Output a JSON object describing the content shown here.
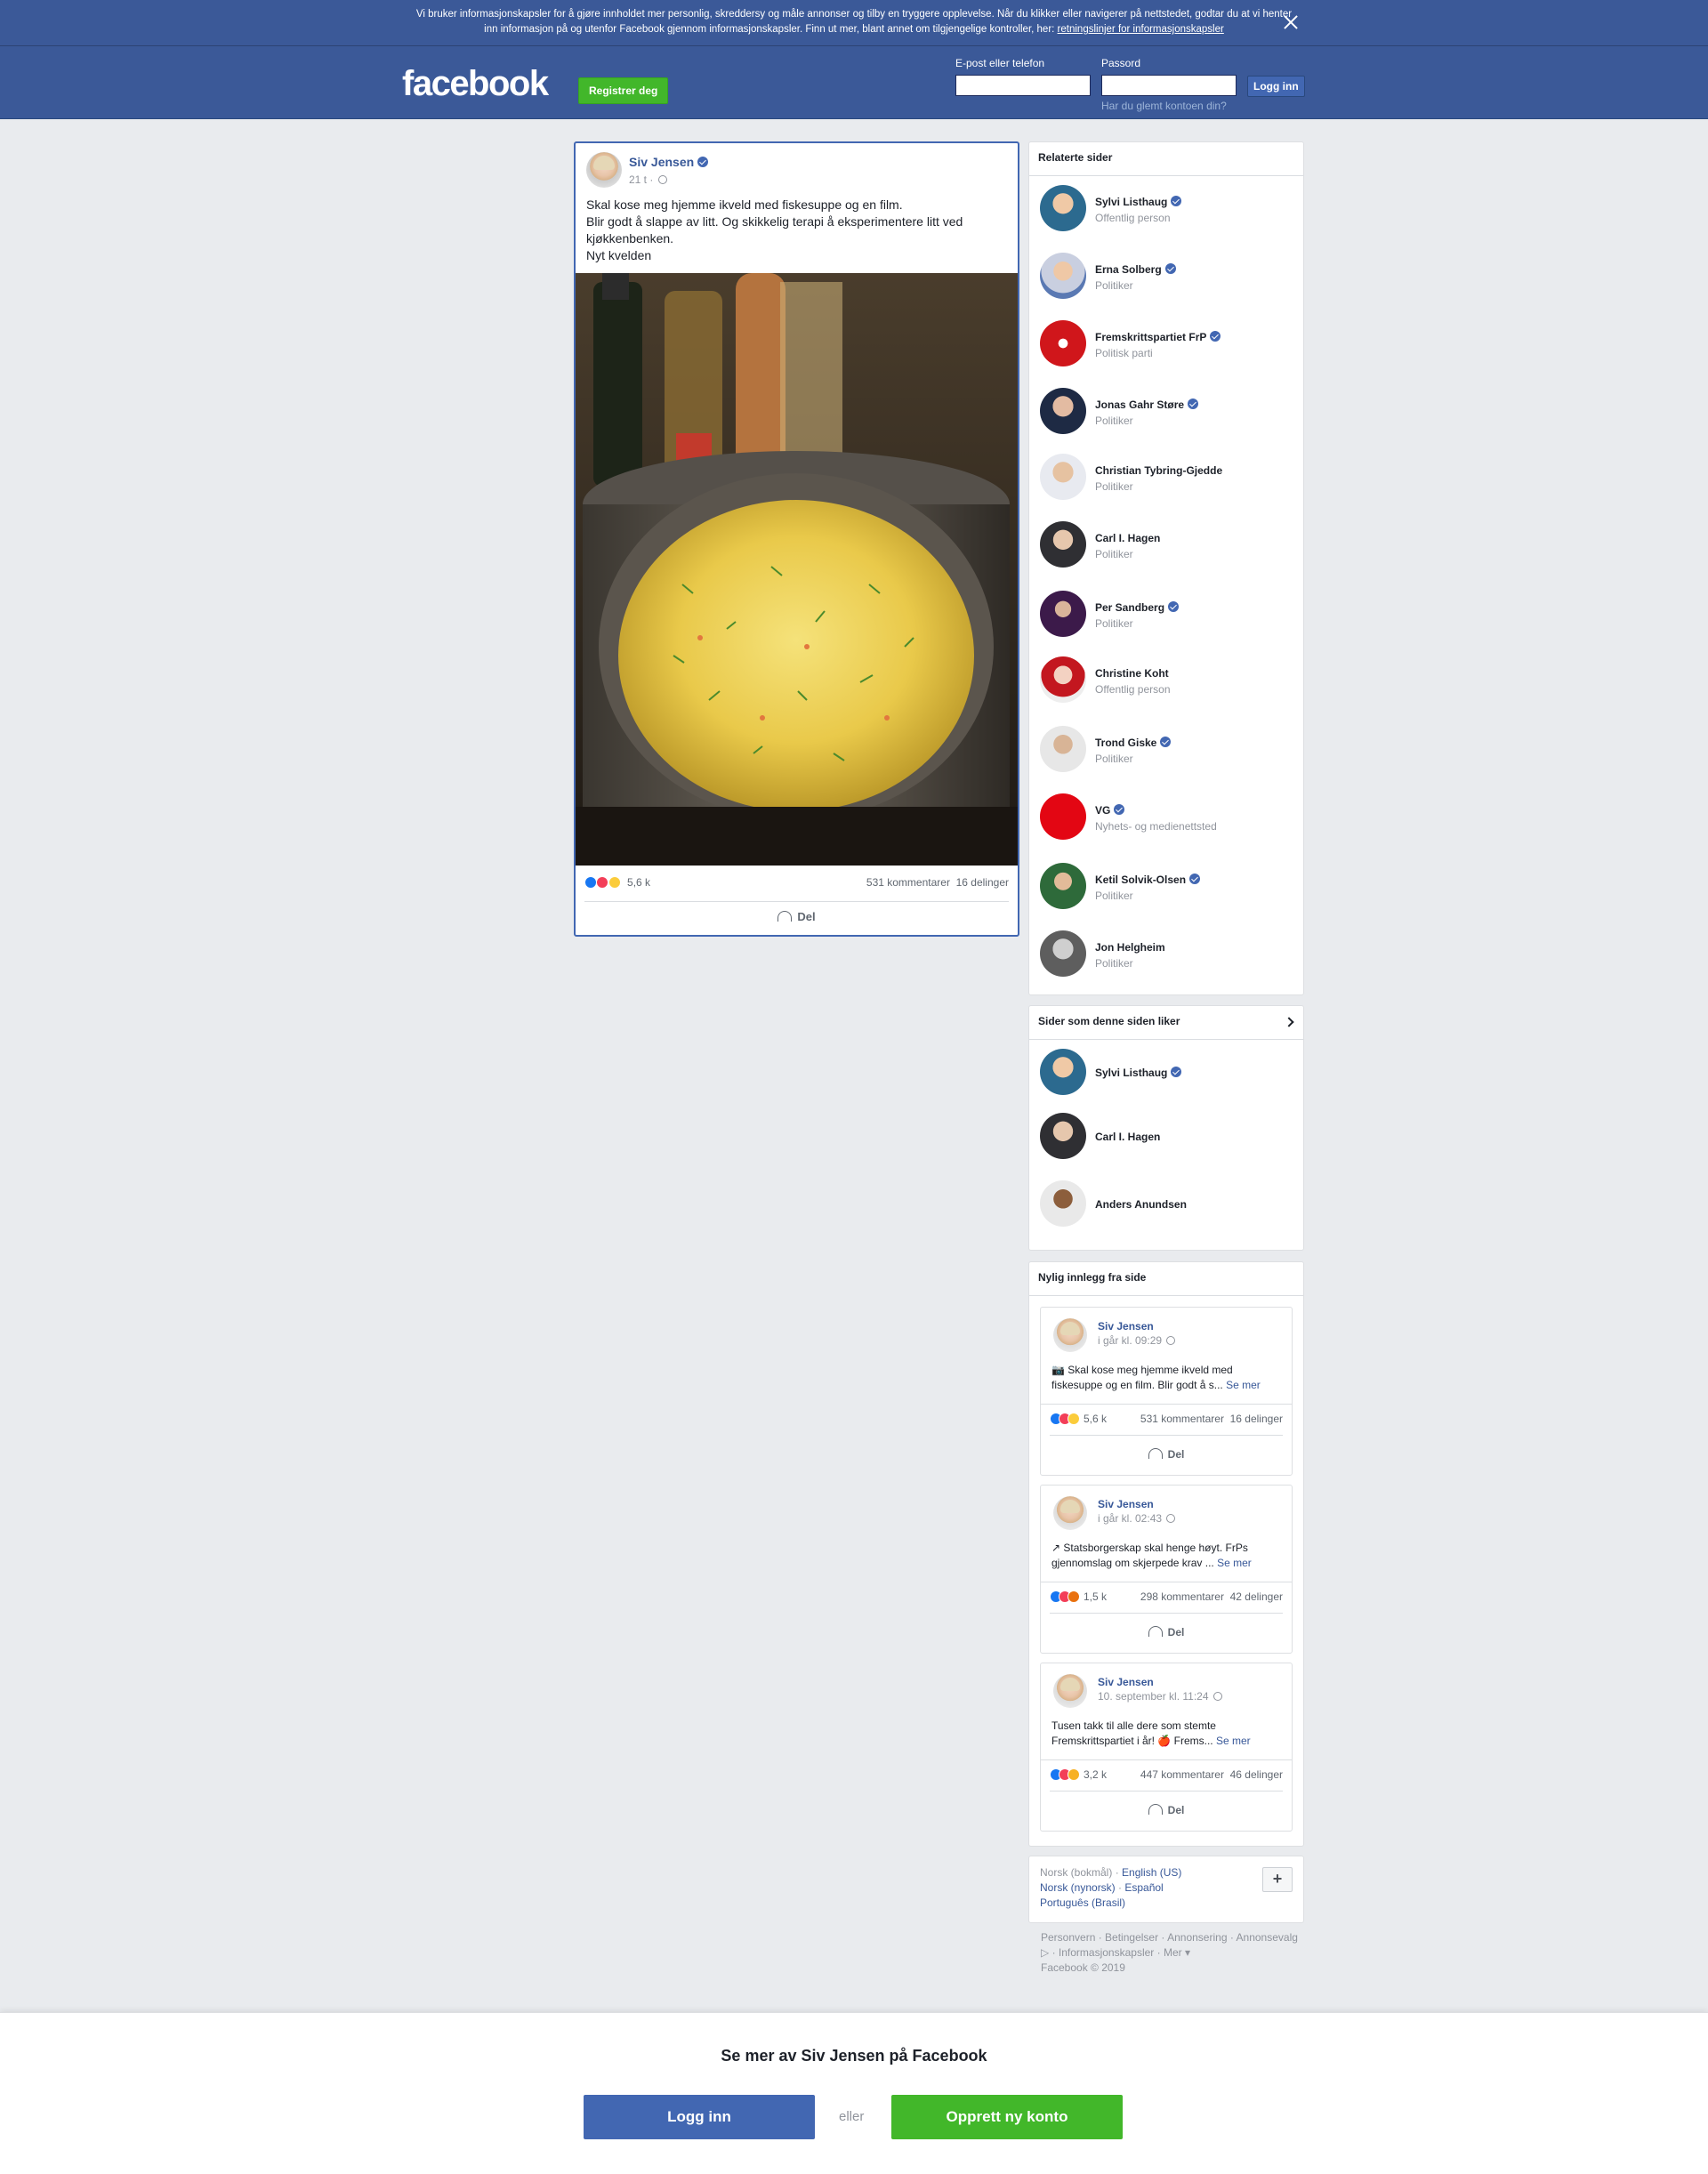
{
  "cookie_banner": {
    "text": "Vi bruker informasjonskapsler for å gjøre innholdet mer personlig, skreddersy og måle annonser og tilby en tryggere opplevelse. Når du klikker eller navigerer på nettstedet, godtar du at vi henter inn informasjon på og utenfor Facebook gjennom informasjonskapsler. Finn ut mer, blant annet om tilgjengelige kontroller, her: ",
    "link": "retningslinjer for informasjonskapsler"
  },
  "header": {
    "logo": "facebook",
    "register": "Registrer deg",
    "email_label": "E-post eller telefon",
    "password_label": "Passord",
    "login": "Logg inn",
    "forgot": "Har du glemt kontoen din?"
  },
  "post": {
    "author": "Siv Jensen",
    "time": "21 t ·",
    "text": [
      "Skal kose meg hjemme ikveld med fiskesuppe og en film.",
      "Blir godt å slappe av litt. Og skikkelig terapi å eksperimentere litt ved kjøkkenbenken.",
      "Nyt kvelden"
    ],
    "reactions_count": "5,6 k",
    "comments": "531 kommentarer",
    "shares": "16 delinger",
    "share_label": "Del"
  },
  "related": {
    "title": "Relaterte sider",
    "items": [
      {
        "name": "Sylvi Listhaug",
        "verified": true,
        "category": "Offentlig person"
      },
      {
        "name": "Erna Solberg",
        "verified": true,
        "category": "Politiker"
      },
      {
        "name": "Fremskrittspartiet FrP",
        "verified": true,
        "category": "Politisk parti"
      },
      {
        "name": "Jonas Gahr Støre",
        "verified": true,
        "category": "Politiker"
      },
      {
        "name": "Christian Tybring-Gjedde",
        "verified": false,
        "category": "Politiker"
      },
      {
        "name": "Carl I. Hagen",
        "verified": false,
        "category": "Politiker"
      },
      {
        "name": "Per Sandberg",
        "verified": true,
        "category": "Politiker"
      },
      {
        "name": "Christine Koht",
        "verified": false,
        "category": "Offentlig person"
      },
      {
        "name": "Trond Giske",
        "verified": true,
        "category": "Politiker"
      },
      {
        "name": "VG",
        "verified": true,
        "category": "Nyhets- og medienettsted"
      },
      {
        "name": "Ketil Solvik-Olsen",
        "verified": true,
        "category": "Politiker"
      },
      {
        "name": "Jon Helgheim",
        "verified": false,
        "category": "Politiker"
      }
    ]
  },
  "liked": {
    "title": "Sider som denne siden liker",
    "items": [
      {
        "name": "Sylvi Listhaug",
        "verified": true
      },
      {
        "name": "Carl I. Hagen",
        "verified": false
      },
      {
        "name": "Anders Anundsen",
        "verified": false
      }
    ]
  },
  "recent": {
    "title": "Nylig innlegg fra side",
    "posts": [
      {
        "author": "Siv Jensen",
        "time": "i går kl. 09:29",
        "text": "Skal kose meg hjemme ikveld med fiskesuppe og en film. Blir godt å s...",
        "icon": "📷",
        "see_more": "Se mer",
        "count": "5,6 k",
        "comments": "531 kommentarer",
        "shares": "16 delinger",
        "share": "Del"
      },
      {
        "author": "Siv Jensen",
        "time": "i går kl. 02:43",
        "text": "Statsborgerskap skal henge høyt. FrPs gjennomslag om skjerpede krav ...",
        "icon": "↗",
        "see_more": "Se mer",
        "count": "1,5 k",
        "comments": "298 kommentarer",
        "shares": "42 delinger",
        "share": "Del"
      },
      {
        "author": "Siv Jensen",
        "time": "10. september kl. 11:24",
        "text": "Tusen takk til alle dere som stemte Fremskrittspartiet i år! 🍎 Frems...",
        "icon": "",
        "see_more": "Se mer",
        "count": "3,2 k",
        "comments": "447 kommentarer",
        "shares": "46 delinger",
        "share": "Del"
      }
    ]
  },
  "languages": {
    "current": "Norsk (bokmål)",
    "links": [
      "English (US)",
      "Norsk (nynorsk)",
      "Español",
      "Português (Brasil)"
    ],
    "plus": "+"
  },
  "footer": {
    "links": [
      "Personvern",
      "Betingelser",
      "Annonsering",
      "Annonsevalg",
      "Informasjonskapsler",
      "Mer"
    ],
    "copyright": "Facebook © 2019"
  },
  "bottom": {
    "title": "Se mer av Siv Jensen på Facebook",
    "login": "Logg inn",
    "or": "eller",
    "signup": "Opprett ny konto"
  }
}
